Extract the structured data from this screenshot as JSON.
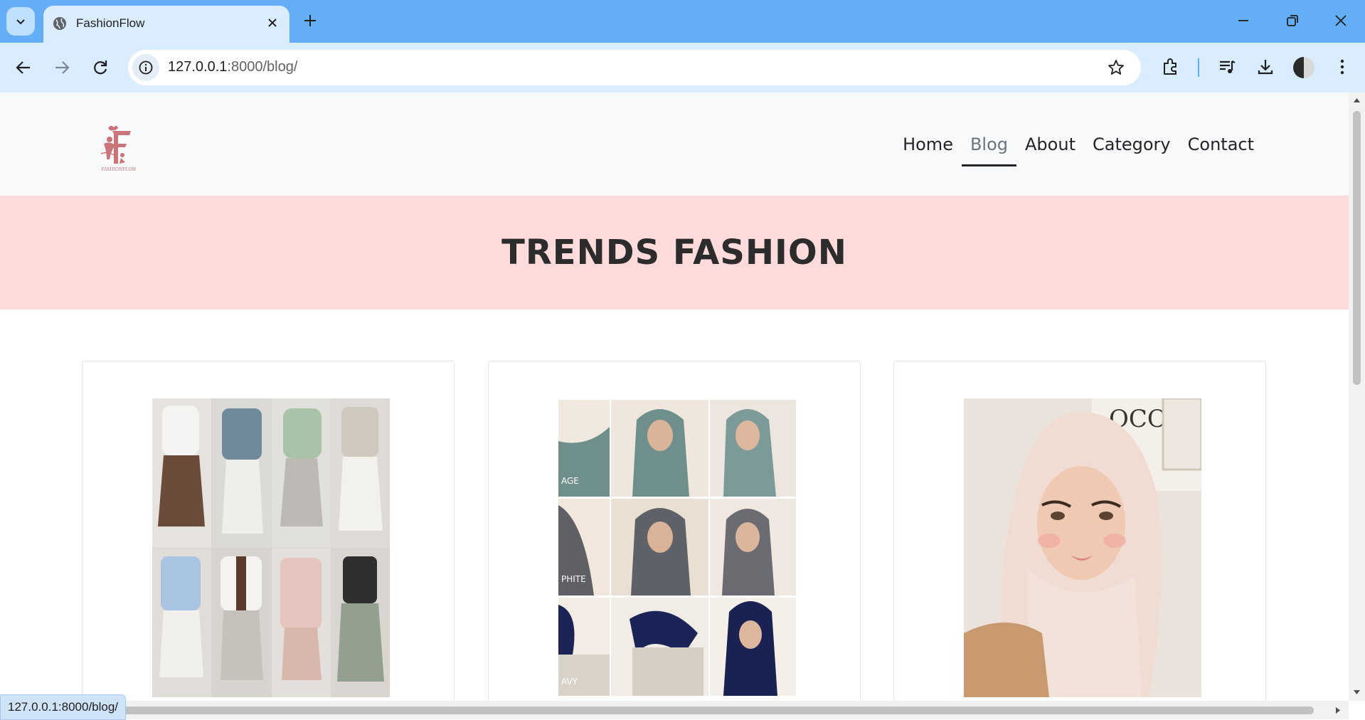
{
  "browser": {
    "tab_title": "FashionFlow",
    "url_host": "127.0.0.1",
    "url_path": ":8000/blog/",
    "status_url": "127.0.0.1:8000/blog/"
  },
  "site": {
    "logo_text": "FASHIONFLOW",
    "nav": [
      {
        "label": "Home",
        "active": false
      },
      {
        "label": "Blog",
        "active": true
      },
      {
        "label": "About",
        "active": false
      },
      {
        "label": "Category",
        "active": false
      },
      {
        "label": "Contact",
        "active": false
      }
    ],
    "hero_title": "TRENDS FASHION"
  },
  "cards": [
    {
      "image": "modest-outfit-collage"
    },
    {
      "image": "hijab-color-swatches",
      "image_labels": [
        "AGE",
        "PHITE",
        "AVY"
      ]
    },
    {
      "image": "hijab-selfie-portrait",
      "image_labels": [
        "OCO"
      ]
    }
  ],
  "colors": {
    "tabbar": "#64aef8",
    "toolbar": "#d9edff",
    "hero_bg": "#ffdbdb",
    "header_bg": "#f8f9fa",
    "logo": "#c9757a"
  },
  "icons": [
    "tab-search-icon",
    "globe-icon",
    "close-icon",
    "new-tab-icon",
    "minimize-icon",
    "restore-icon",
    "window-close-icon",
    "back-icon",
    "forward-icon",
    "reload-icon",
    "info-icon",
    "star-icon",
    "extensions-icon",
    "media-icon",
    "download-icon",
    "menu-icon"
  ]
}
